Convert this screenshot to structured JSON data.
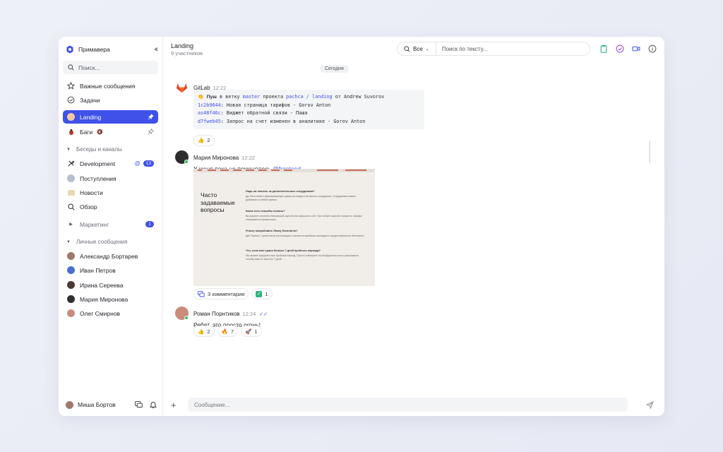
{
  "sidebar": {
    "workspace": "Примавера",
    "search_placeholder": "Поиск...",
    "nav": {
      "important": "Важные сообщения",
      "tasks": "Задачи",
      "landing": "Landing",
      "bugs": "Баги"
    },
    "sections": {
      "chats": "Беседы и каналы",
      "personal": "Личные сообщения"
    },
    "channels": {
      "development": "Development",
      "development_badge": "13",
      "incoming": "Поступления",
      "news": "Новости",
      "overview": "Обзор",
      "marketing": "Маркетинг",
      "marketing_badge": "1"
    },
    "people": [
      "Александр Бортарев",
      "Иван Петров",
      "Ирина Сереева",
      "Мария Миронова",
      "Олег Смирнов"
    ],
    "user": "Миша Бортов"
  },
  "header": {
    "title": "Landing",
    "subtitle": "9 участников",
    "filter_value": "Все",
    "search_placeholder": "Поиск по тексту..."
  },
  "chat": {
    "date_label": "Сегодня",
    "gitlab": {
      "author": "GitLab",
      "time": "12:22",
      "push_prefix": "Пуш",
      "push_mid1": " в ветку ",
      "branch": "master",
      "push_mid2": " проекта ",
      "repo": "pachca / landing",
      "push_mid3": " от Andrew Suvorov",
      "commits": [
        {
          "hash": "1c2b9644",
          "text": ": Новая страница тарифов - Gorov Anton"
        },
        {
          "hash": "as48f46c",
          "text": ": Виджет обратной связи - Паша"
        },
        {
          "hash": "d7fweb45",
          "text": ": Запрос на счет изменен в аналитике - Gorov Anton"
        }
      ],
      "reaction_count": "2"
    },
    "maria": {
      "author": "Мария Миронова",
      "time": "12:22",
      "text": "У меня пока не поменялось",
      "mention": "@frontend",
      "comments": "3 комментария",
      "check_count": "1",
      "shot": {
        "title": "Часто задаваемые вопросы",
        "questions": [
          {
            "q": "Надо ли платить за дополнительных сотрудников?",
            "a": "Да. Вы платите фиксированную сумму за каждого активного сотрудника. Сотрудников можно добавлять в любое время."
          },
          {
            "q": "Какие есть способы оплаты?",
            "a": "Вы можете оплатить банковской картой или запросить счёт. При оплате картой стоимость тарифа списывается ежемесячно."
          },
          {
            "q": "Я могу попробовать Пачку бесплатно?",
            "a": "Да! Первые 7 дней после регистрации считаются пробным периодом и предоставляются бесплатно."
          },
          {
            "q": "Что, если мне нужно больше 7 дней пробного периода?",
            "a": "Мы можем продлить вам пробный период. Просто напишите на info@pachca.com и расскажите, почему вам не хватило 7 дней."
          }
        ]
      }
    },
    "roman": {
      "author": "Роман Порнтиков",
      "time": "12:24",
      "text": "Ребят, это просто огонь!",
      "reactions": [
        {
          "emoji": "👍",
          "count": "2"
        },
        {
          "emoji": "🔥",
          "count": "7"
        },
        {
          "emoji": "🚀",
          "count": "1"
        }
      ]
    }
  },
  "composer": {
    "placeholder": "Сообщение..."
  },
  "colors": {
    "accent": "#3f51e8",
    "online": "#33c25a",
    "gitlab": "#e2432a"
  }
}
